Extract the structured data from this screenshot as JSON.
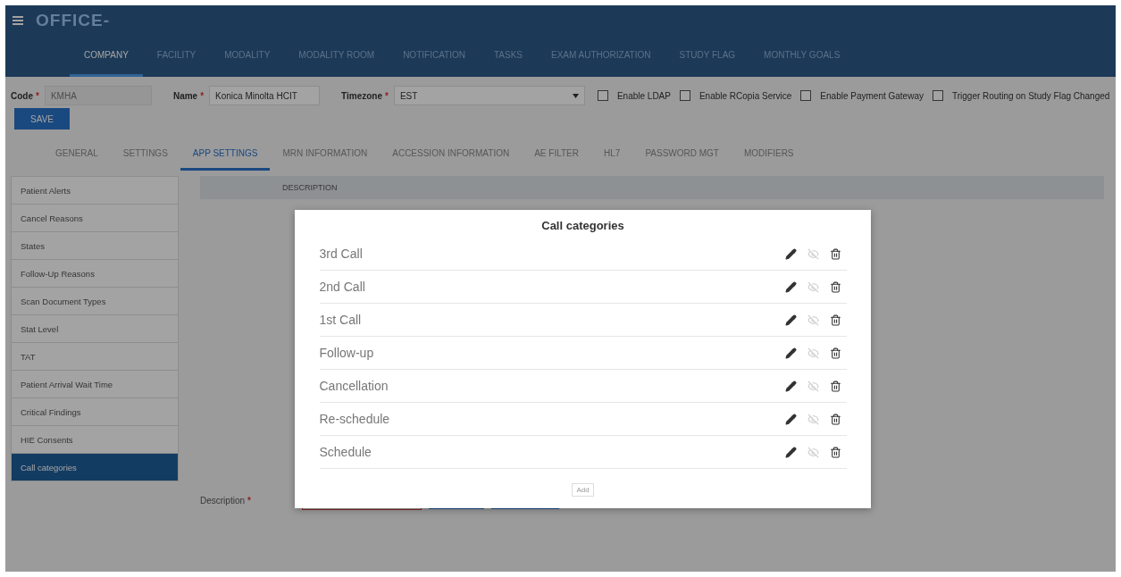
{
  "app": {
    "title": "OFFICE-"
  },
  "main_tabs": [
    {
      "label": "COMPANY",
      "selected": true
    },
    {
      "label": "FACILITY",
      "selected": false
    },
    {
      "label": "MODALITY",
      "selected": false
    },
    {
      "label": "MODALITY ROOM",
      "selected": false
    },
    {
      "label": "NOTIFICATION",
      "selected": false
    },
    {
      "label": "TASKS",
      "selected": false
    },
    {
      "label": "EXAM AUTHORIZATION",
      "selected": false
    },
    {
      "label": "STUDY FLAG",
      "selected": false
    },
    {
      "label": "MONTHLY GOALS",
      "selected": false
    }
  ],
  "company_form": {
    "code": {
      "label": "Code",
      "required_mark": "*",
      "value": "KMHA",
      "disabled": true
    },
    "name": {
      "label": "Name",
      "required_mark": "*",
      "value": "Konica Minolta HCIT"
    },
    "timezone": {
      "label": "Timezone",
      "required_mark": "*",
      "value": "EST"
    },
    "options": [
      {
        "label": "Enable LDAP",
        "checked": false
      },
      {
        "label": "Enable RCopia Service",
        "checked": false
      },
      {
        "label": "Enable Payment Gateway",
        "checked": false
      },
      {
        "label": "Trigger Routing on Study Flag Changed",
        "checked": false
      }
    ],
    "save_button": "SAVE"
  },
  "sub_tabs": [
    {
      "label": "GENERAL",
      "selected": false
    },
    {
      "label": "SETTINGS",
      "selected": false
    },
    {
      "label": "APP SETTINGS",
      "selected": true
    },
    {
      "label": "MRN INFORMATION",
      "selected": false
    },
    {
      "label": "ACCESSION INFORMATION",
      "selected": false
    },
    {
      "label": "AE FILTER",
      "selected": false
    },
    {
      "label": "HL7",
      "selected": false
    },
    {
      "label": "PASSWORD MGT",
      "selected": false
    },
    {
      "label": "MODIFIERS",
      "selected": false
    }
  ],
  "sidebar": {
    "items": [
      {
        "label": "Patient Alerts",
        "selected": false
      },
      {
        "label": "Cancel Reasons",
        "selected": false
      },
      {
        "label": "States",
        "selected": false
      },
      {
        "label": "Follow-Up Reasons",
        "selected": false
      },
      {
        "label": "Scan Document Types",
        "selected": false
      },
      {
        "label": "Stat Level",
        "selected": false
      },
      {
        "label": "TAT",
        "selected": false
      },
      {
        "label": "Patient Arrival Wait Time",
        "selected": false
      },
      {
        "label": "Critical Findings",
        "selected": false
      },
      {
        "label": "HIE Consents",
        "selected": false
      },
      {
        "label": "Call categories",
        "selected": true
      }
    ]
  },
  "table": {
    "columns": [
      "DESCRIPTION"
    ]
  },
  "description_field": {
    "label": "Description",
    "required_mark": "*",
    "invalid": true
  },
  "dialog": {
    "title": "Call categories",
    "rows": [
      {
        "label": "3rd Call"
      },
      {
        "label": "2nd Call"
      },
      {
        "label": "1st Call"
      },
      {
        "label": "Follow-up"
      },
      {
        "label": "Cancellation"
      },
      {
        "label": "Re-schedule"
      },
      {
        "label": "Schedule"
      }
    ],
    "add_button": "Add"
  }
}
